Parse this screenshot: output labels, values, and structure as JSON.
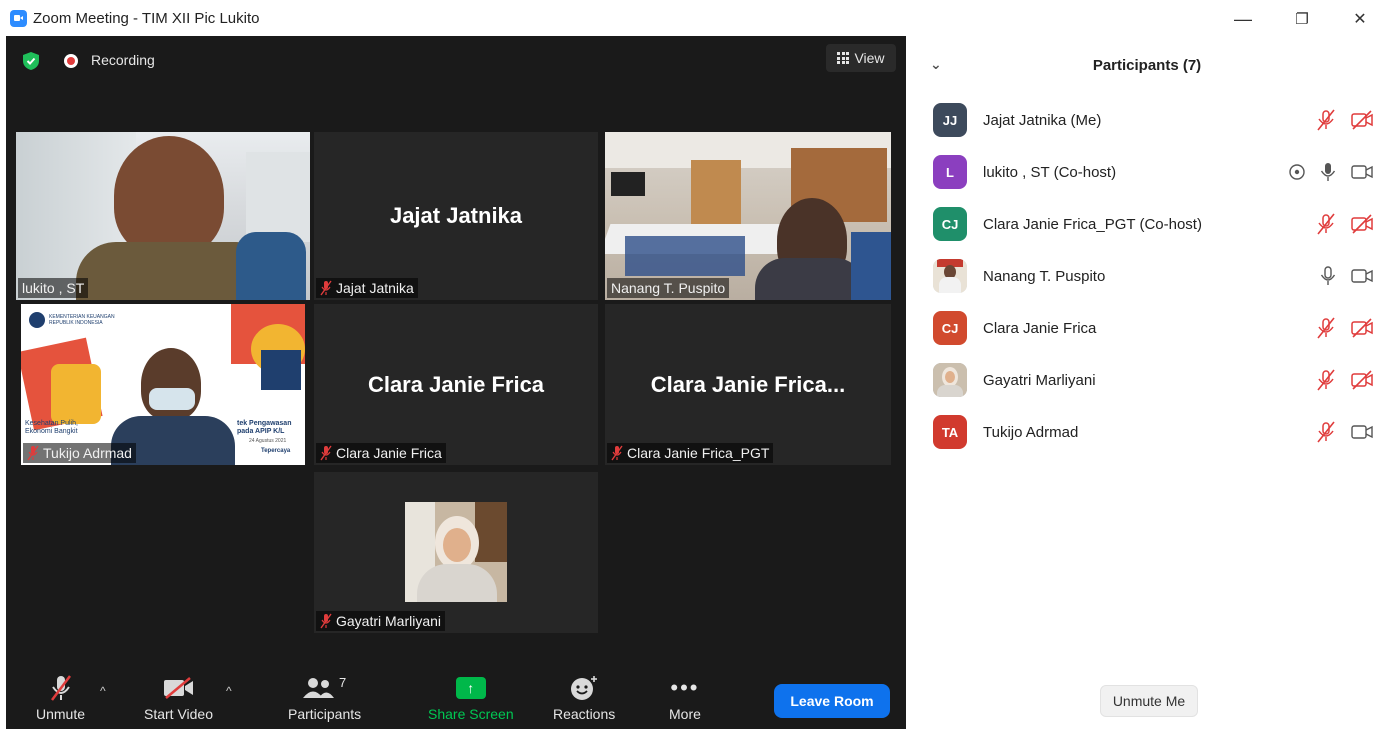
{
  "window": {
    "title": "Zoom Meeting - TIM XII Pic Lukito",
    "minimize": "—",
    "restore": "❐",
    "close": "✕"
  },
  "meeting": {
    "recording_label": "Recording",
    "view_label": "View",
    "tiles": [
      {
        "id": "lukito",
        "name": "lukito , ST",
        "type": "video",
        "active_speaker": true,
        "muted": false
      },
      {
        "id": "jajat",
        "name": "Jajat Jatnika",
        "big_name": "Jajat Jatnika",
        "type": "name",
        "muted": true
      },
      {
        "id": "nanang",
        "name": "Nanang T. Puspito",
        "type": "video",
        "muted": false
      },
      {
        "id": "tukijo",
        "name": "Tukijo Adrmad",
        "type": "video",
        "muted": true
      },
      {
        "id": "clara",
        "name": "Clara Janie Frica",
        "big_name": "Clara Janie Frica",
        "type": "name",
        "muted": true
      },
      {
        "id": "clara_pgt",
        "name": "Clara Janie Frica_PGT",
        "big_name": "Clara  Janie  Frica...",
        "type": "name",
        "muted": true
      },
      {
        "id": "gayatri",
        "name": "Gayatri Marliyani",
        "type": "photo",
        "muted": true
      }
    ],
    "slide_text": {
      "ministry": "KEMENTERIAN KEUANGAN REPUBLIK INDONESIA",
      "left": "Kesehatan Pulih, Ekonomi Bangkit",
      "right": "tek Pengawasan pada APIP K/L",
      "date": "24 Agustus 2021",
      "footer": "Tepercaya"
    }
  },
  "toolbar": {
    "unmute": "Unmute",
    "start_video": "Start Video",
    "participants": "Participants",
    "participants_count": "7",
    "share_screen": "Share Screen",
    "reactions": "Reactions",
    "more": "More",
    "leave_room": "Leave Room",
    "caret": "^"
  },
  "panel": {
    "title": "Participants (7)",
    "participants": [
      {
        "name": "Jajat Jatnika (Me)",
        "initials": "JJ",
        "color": "#3d4a5c",
        "mic": "muted",
        "video": "off"
      },
      {
        "name": "lukito , ST (Co-host)",
        "initials": "L",
        "color": "#8b3fbf",
        "mic": "on",
        "video": "on",
        "sharing_indicator": true
      },
      {
        "name": "Clara Janie Frica_PGT (Co-host)",
        "initials": "CJ",
        "color": "#1f8f6a",
        "mic": "muted",
        "video": "off"
      },
      {
        "name": "Nanang T. Puspito",
        "initials": "",
        "color": "#cfd8dc",
        "mic": "on",
        "video": "on",
        "photo": true
      },
      {
        "name": "Clara Janie Frica",
        "initials": "CJ",
        "color": "#d14a2e",
        "mic": "muted",
        "video": "off"
      },
      {
        "name": "Gayatri Marliyani",
        "initials": "",
        "color": "#b0b8bf",
        "mic": "muted",
        "video": "off",
        "photo": true
      },
      {
        "name": "Tukijo Adrmad",
        "initials": "TA",
        "color": "#d13a2e",
        "mic": "muted",
        "video": "on"
      }
    ],
    "unmute_me": "Unmute Me"
  },
  "colors": {
    "accent": "#0e72ed",
    "muted_red": "#e03c3c",
    "speaker_border": "#cfe65c",
    "share_green": "#00b84a"
  }
}
